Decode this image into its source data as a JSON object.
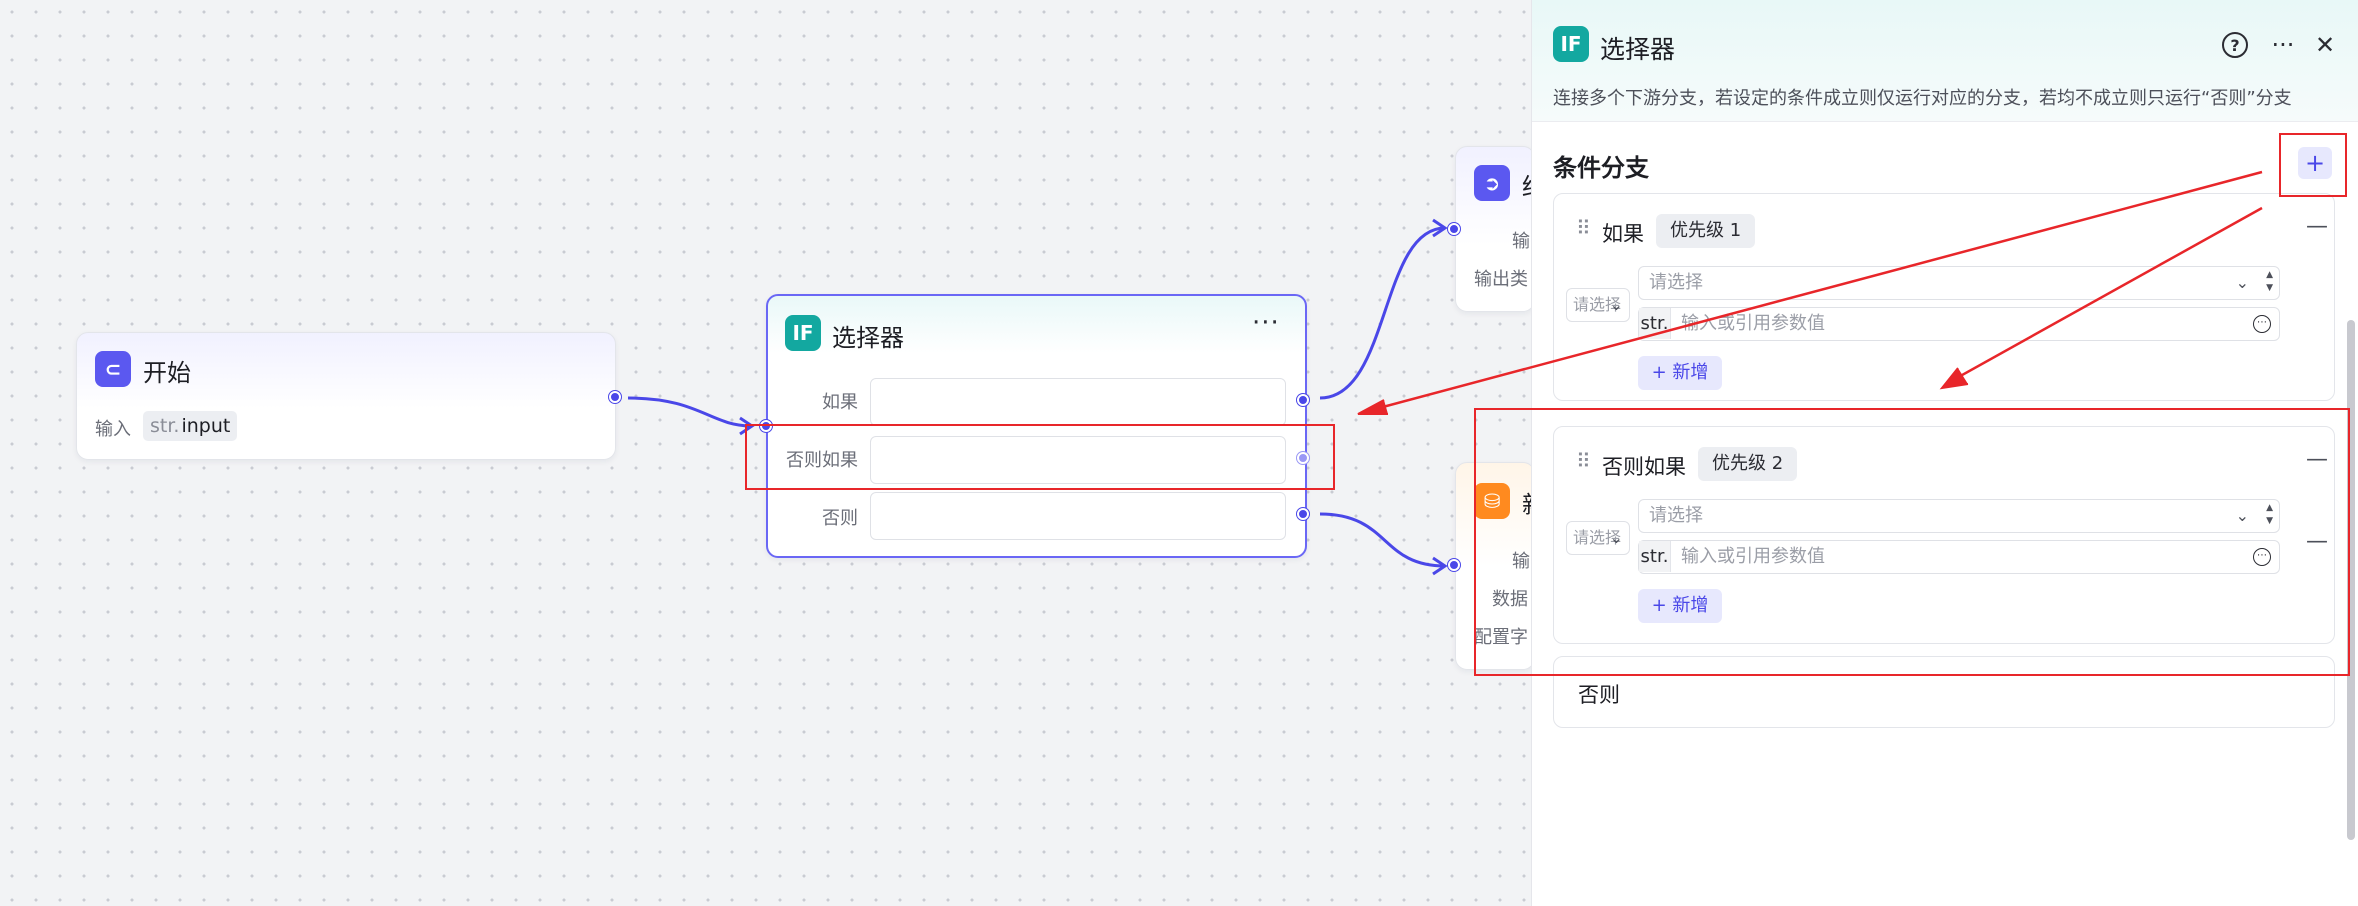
{
  "canvas": {
    "start_node": {
      "title": "开始",
      "input_label": "输入",
      "param_type": "str.",
      "param_name": "input"
    },
    "selector_node": {
      "title": "选择器",
      "icon": "IF",
      "rows": [
        "如果",
        "否则如果",
        "否则"
      ]
    },
    "side_node_1": {
      "title": "结",
      "row1": "输",
      "row2": "输出类"
    },
    "side_node_2": {
      "title": "新",
      "row1": "输",
      "row2": "数据",
      "row3": "配置字"
    }
  },
  "panel": {
    "icon": "IF",
    "title": "选择器",
    "description": "连接多个下游分支，若设定的条件成立则仅运行对应的分支，若均不成立则只运行“否则”分支",
    "section_title": "条件分支",
    "branches": [
      {
        "title": "如果",
        "priority": "优先级 1",
        "logic": "请选择",
        "select_placeholder": "请选择",
        "value_type": "str.",
        "value_placeholder": "输入或引用参数值",
        "add_label": "新增"
      },
      {
        "title": "否则如果",
        "priority": "优先级 2",
        "logic": "请选择",
        "select_placeholder": "请选择",
        "value_type": "str.",
        "value_placeholder": "输入或引用参数值",
        "add_label": "新增"
      }
    ],
    "else_label": "否则"
  },
  "colors": {
    "accent": "#4a47e8",
    "teal": "#13a8a0",
    "annotation": "#e8262a"
  }
}
